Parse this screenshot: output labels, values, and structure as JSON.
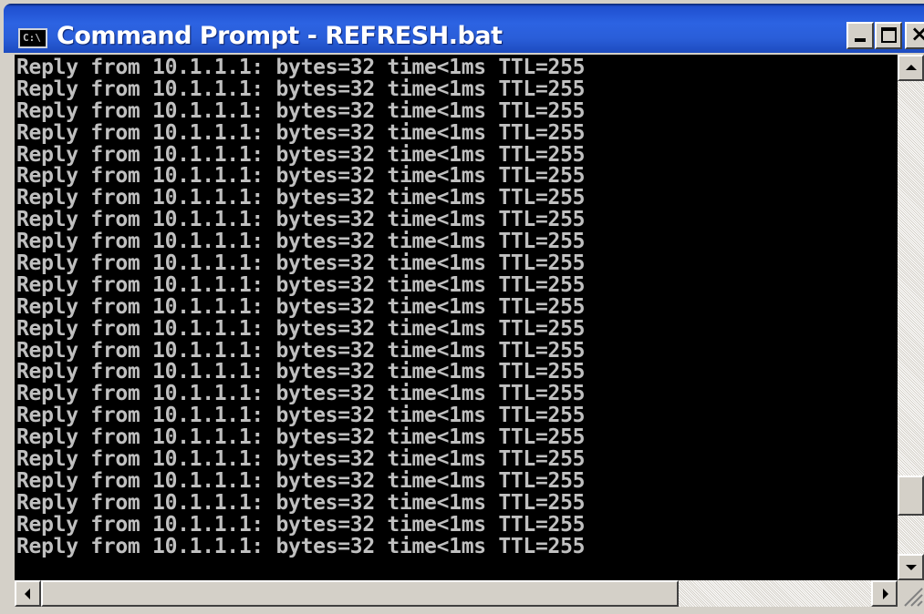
{
  "window": {
    "title": "Command Prompt - REFRESH.bat",
    "icon": "console-icon",
    "icon_text": "C:\\"
  },
  "titlebar_buttons": {
    "minimize": "minimize-icon",
    "maximize": "maximize-icon",
    "close_glyph": "×"
  },
  "console": {
    "background": "#000000",
    "foreground": "#c0c0c0",
    "lines": [
      "Reply from 10.1.1.1: bytes=32 time<1ms TTL=255",
      "Reply from 10.1.1.1: bytes=32 time<1ms TTL=255",
      "Reply from 10.1.1.1: bytes=32 time<1ms TTL=255",
      "Reply from 10.1.1.1: bytes=32 time<1ms TTL=255",
      "Reply from 10.1.1.1: bytes=32 time<1ms TTL=255",
      "Reply from 10.1.1.1: bytes=32 time<1ms TTL=255",
      "Reply from 10.1.1.1: bytes=32 time<1ms TTL=255",
      "Reply from 10.1.1.1: bytes=32 time<1ms TTL=255",
      "Reply from 10.1.1.1: bytes=32 time<1ms TTL=255",
      "Reply from 10.1.1.1: bytes=32 time<1ms TTL=255",
      "Reply from 10.1.1.1: bytes=32 time<1ms TTL=255",
      "Reply from 10.1.1.1: bytes=32 time<1ms TTL=255",
      "Reply from 10.1.1.1: bytes=32 time<1ms TTL=255",
      "Reply from 10.1.1.1: bytes=32 time<1ms TTL=255",
      "Reply from 10.1.1.1: bytes=32 time<1ms TTL=255",
      "Reply from 10.1.1.1: bytes=32 time<1ms TTL=255",
      "Reply from 10.1.1.1: bytes=32 time<1ms TTL=255",
      "Reply from 10.1.1.1: bytes=32 time<1ms TTL=255",
      "Reply from 10.1.1.1: bytes=32 time<1ms TTL=255",
      "Reply from 10.1.1.1: bytes=32 time<1ms TTL=255",
      "Reply from 10.1.1.1: bytes=32 time<1ms TTL=255",
      "Reply from 10.1.1.1: bytes=32 time<1ms TTL=255",
      "Reply from 10.1.1.1: bytes=32 time<1ms TTL=255"
    ]
  },
  "colors": {
    "titlebar_accent": "#2a5ed9",
    "chrome": "#d4d0c8"
  }
}
